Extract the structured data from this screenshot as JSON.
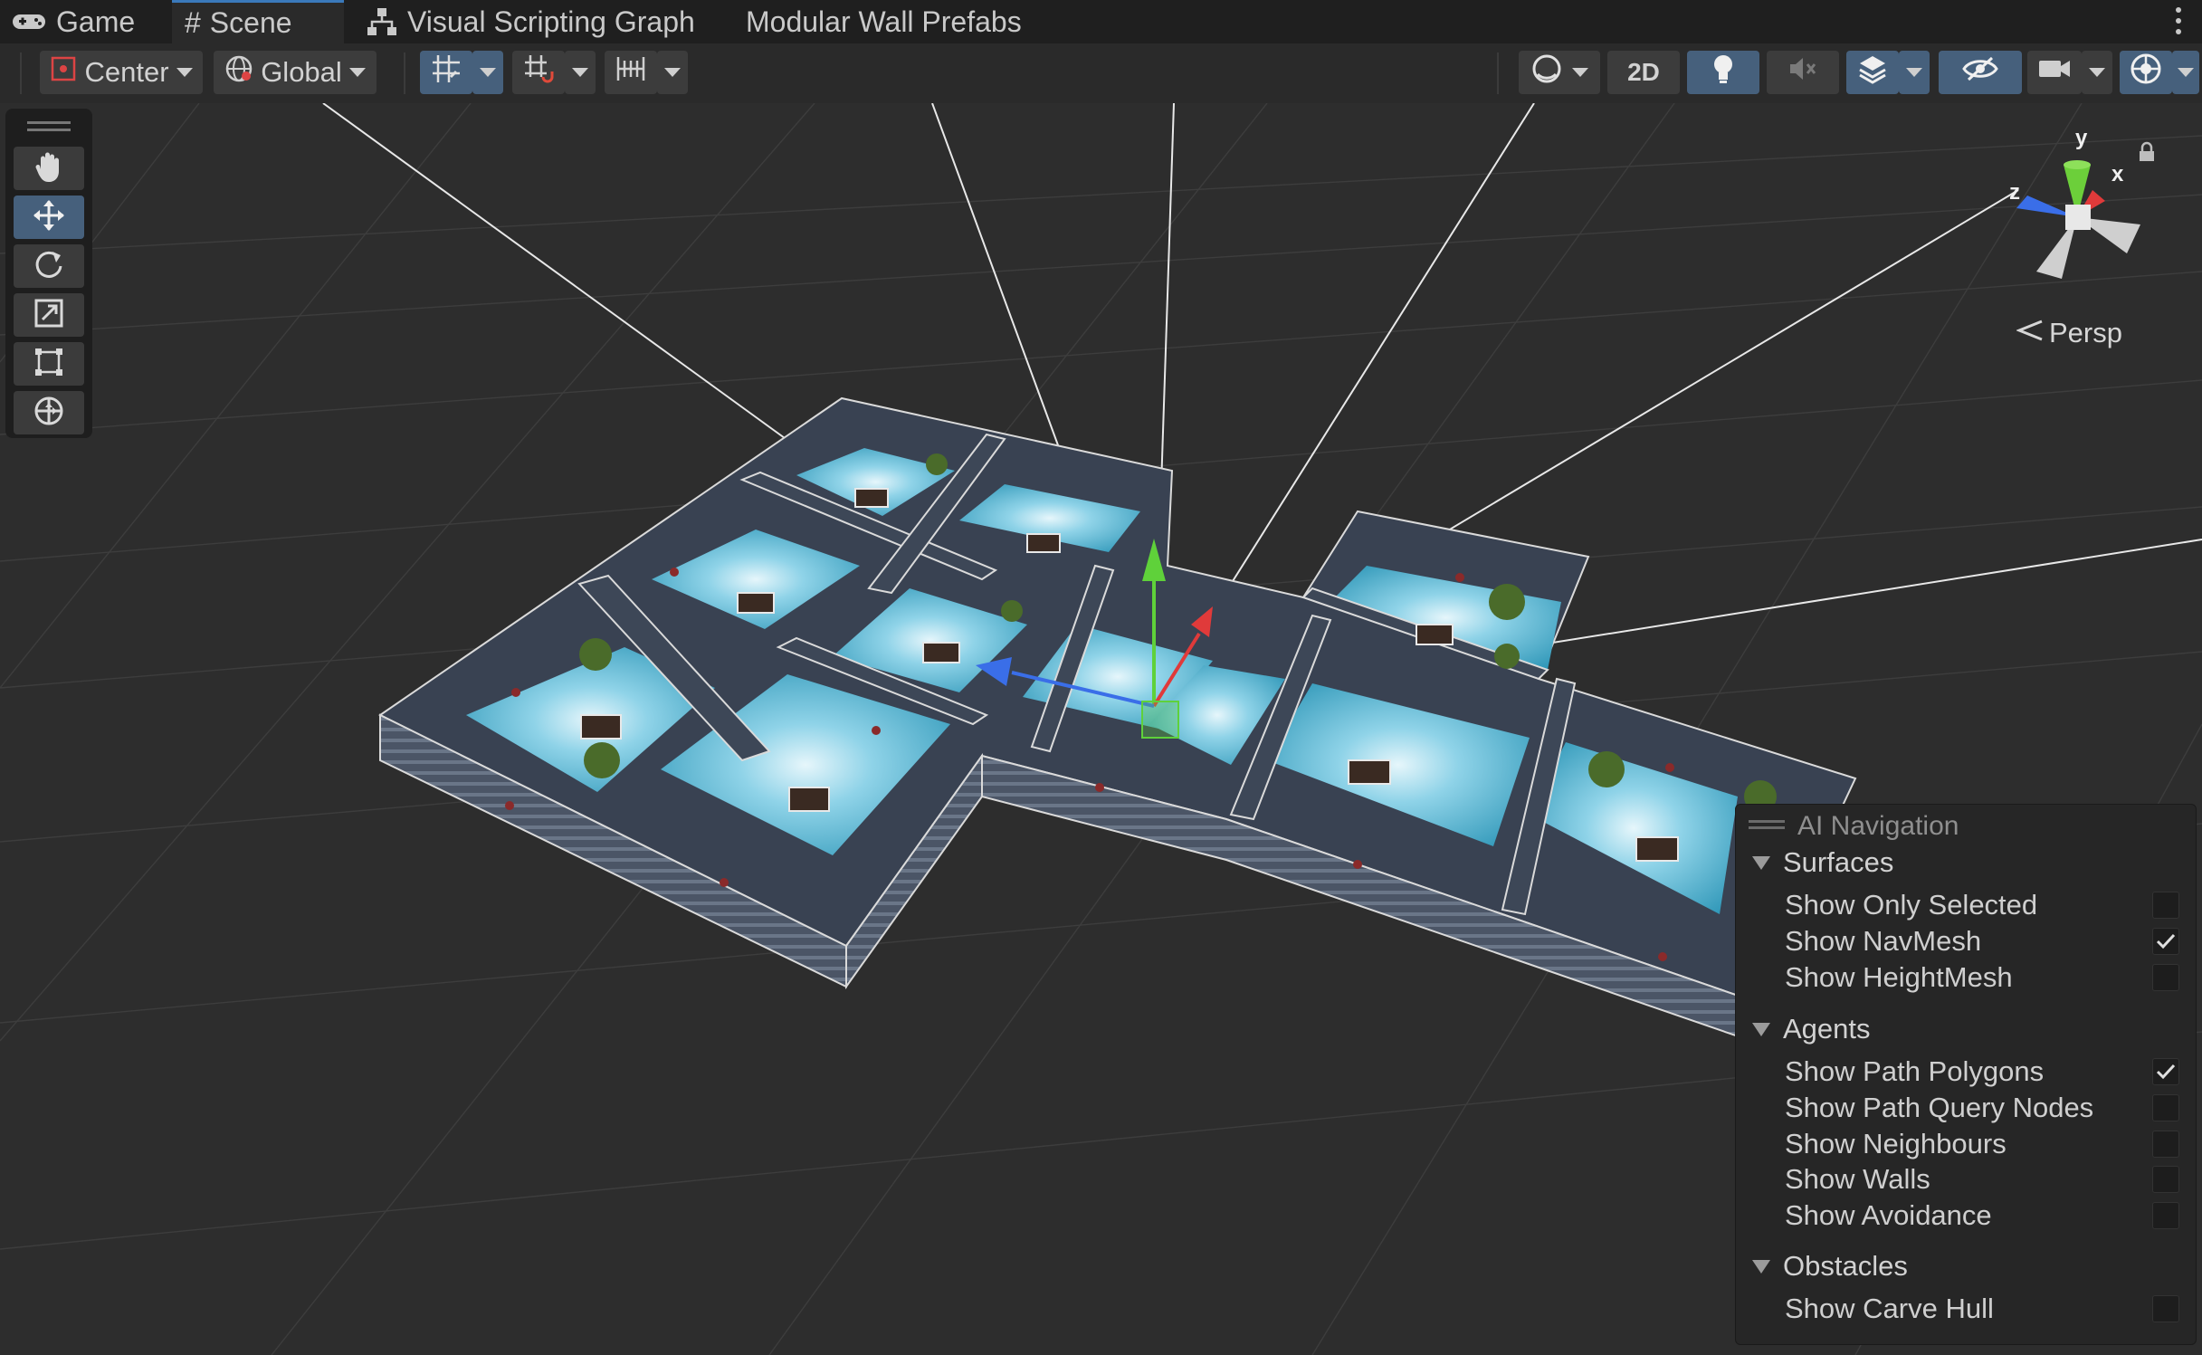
{
  "tabs": [
    {
      "label": "Game",
      "icon": "gamepad-icon"
    },
    {
      "label": "Scene",
      "icon": "scene-grid-icon",
      "active": true
    },
    {
      "label": "Visual Scripting Graph",
      "icon": "graph-hierarchy-icon"
    },
    {
      "label": "Modular Wall Prefabs"
    }
  ],
  "toolbar": {
    "pivot_mode": "Center",
    "pivot_rotation": "Global",
    "two_d_label": "2D"
  },
  "tools": [
    "hand-tool",
    "move-tool",
    "rotate-tool",
    "scale-tool",
    "rect-tool",
    "transform-tool"
  ],
  "active_tool": "move-tool",
  "gizmo": {
    "axis_y": "y",
    "axis_x": "x",
    "axis_z": "z",
    "projection": "Persp"
  },
  "ai_navigation": {
    "title": "AI Navigation",
    "sections": [
      {
        "label": "Surfaces",
        "options": [
          {
            "label": "Show Only Selected",
            "checked": false
          },
          {
            "label": "Show NavMesh",
            "checked": true
          },
          {
            "label": "Show HeightMesh",
            "checked": false
          }
        ]
      },
      {
        "label": "Agents",
        "options": [
          {
            "label": "Show Path Polygons",
            "checked": true
          },
          {
            "label": "Show Path Query Nodes",
            "checked": false
          },
          {
            "label": "Show Neighbours",
            "checked": false
          },
          {
            "label": "Show Walls",
            "checked": false
          },
          {
            "label": "Show Avoidance",
            "checked": false
          }
        ]
      },
      {
        "label": "Obstacles",
        "options": [
          {
            "label": "Show Carve Hull",
            "checked": false
          }
        ]
      }
    ]
  },
  "colors": {
    "accent": "#46607c",
    "viewport_bg": "#2d2d2d",
    "axis_x": "#e03a3a",
    "axis_y": "#5fd13a",
    "axis_z": "#3a6ee8",
    "navmesh_water": "#4fb6d2"
  }
}
